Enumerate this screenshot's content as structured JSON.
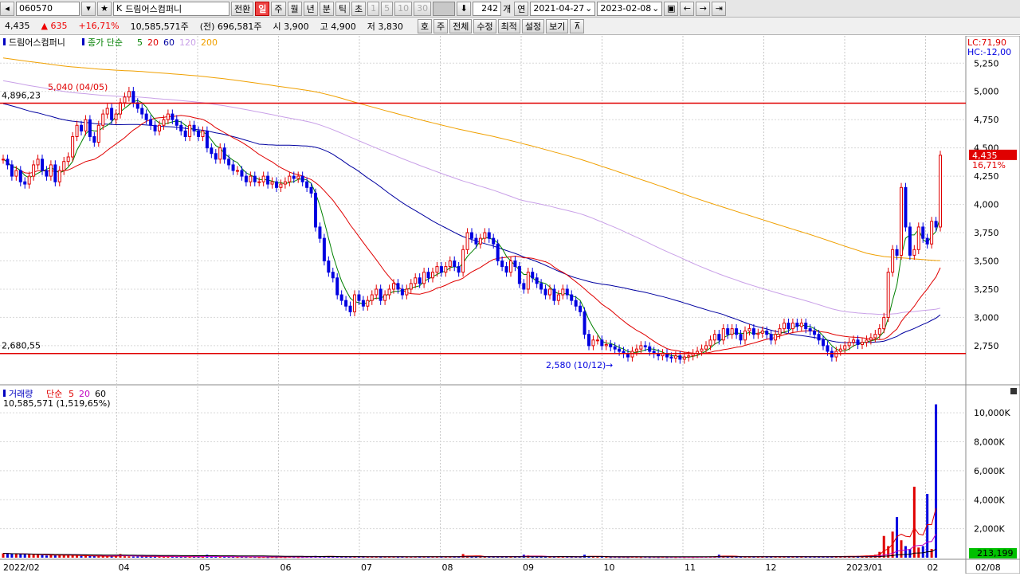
{
  "toolbar": {
    "code": "060570",
    "market_prefix": "K",
    "name": "드림어스컴퍼니",
    "switch_label": "전환",
    "periods": [
      "일",
      "주",
      "월",
      "년",
      "분",
      "틱",
      "초"
    ],
    "active_period": "일",
    "minute_options": [
      "1",
      "5",
      "10",
      "30"
    ],
    "count": "242",
    "count_unit": "개",
    "date_mode": "연",
    "date_from": "2021-04-27",
    "date_to": "2023-02-08"
  },
  "quote": {
    "price": "4,435",
    "change": "▲ 635",
    "change_pct": "+16,71%",
    "volume": "10,585,571주",
    "prev_volume": "(전) 696,581주",
    "open": "시 3,900",
    "high": "고 4,900",
    "low": "저 3,830",
    "buttons": [
      "호",
      "주",
      "전체",
      "수정",
      "최적",
      "설정",
      "보기"
    ]
  },
  "price_panel": {
    "legend_name": "드림어스컴퍼니",
    "ma_label": "종가 단순",
    "ma_periods": [
      "5",
      "20",
      "60",
      "120",
      "200"
    ],
    "ma_colors": [
      "#008000",
      "#e00000",
      "#0000a0",
      "#c9a0e8",
      "#f0a000"
    ],
    "lc_label": "LC:71,90",
    "hc_label": "HC:-12,00",
    "hline_upper": "4,896,23",
    "hline_lower": "2,680,55",
    "hline_upper_value": 4896.23,
    "hline_lower_value": 2680.55,
    "max_annotation": "5,040 (04/05)",
    "max_value": 5040,
    "min_annotation": "2,580 (10/12)",
    "min_value": 2580,
    "current_price_tag": "4,435",
    "current_pct_tag": "16,71%",
    "current_value": 4435,
    "y_ticks": [
      "5,250",
      "5,000",
      "4,750",
      "4,500",
      "4,250",
      "4,000",
      "3,750",
      "3,500",
      "3,250",
      "3,000",
      "2,750"
    ],
    "y_tick_values": [
      5250,
      5000,
      4750,
      4500,
      4250,
      4000,
      3750,
      3500,
      3250,
      3000,
      2750
    ],
    "y_range": [
      2580,
      5400
    ]
  },
  "volume_panel": {
    "legend_name": "거래량",
    "ma_label": "단순",
    "ma_periods": [
      "5",
      "20",
      "60"
    ],
    "ma_colors": [
      "#e00000",
      "#c000c0",
      "#000000"
    ],
    "current_volume": "10,585,571 (1,519,65%)",
    "y_ticks": [
      "10,000K",
      "8,000K",
      "6,000K",
      "4,000K",
      "2,000K"
    ],
    "y_tick_values": [
      10000,
      8000,
      6000,
      4000,
      2000
    ],
    "y_range": [
      0,
      11000
    ],
    "last_tag": "213,199"
  },
  "x_axis": {
    "labels": [
      "2022/02",
      "04",
      "05",
      "06",
      "07",
      "08",
      "09",
      "10",
      "11",
      "12",
      "2023/01",
      "02",
      "02/08"
    ]
  },
  "chart_data": {
    "type": "candlestick",
    "start_date": "2022-02-01",
    "days_per_candle": 1.5,
    "price_closes": [
      4400,
      4350,
      4250,
      4300,
      4200,
      4180,
      4250,
      4350,
      4400,
      4300,
      4250,
      4350,
      4200,
      4300,
      4380,
      4420,
      4600,
      4700,
      4650,
      4750,
      4600,
      4550,
      4700,
      4800,
      4850,
      4750,
      4800,
      4900,
      4950,
      5000,
      4900,
      4850,
      4800,
      4750,
      4700,
      4650,
      4700,
      4750,
      4800,
      4750,
      4700,
      4650,
      4600,
      4700,
      4650,
      4600,
      4650,
      4500,
      4450,
      4400,
      4500,
      4400,
      4350,
      4300,
      4300,
      4250,
      4200,
      4250,
      4200,
      4200,
      4250,
      4180,
      4200,
      4150,
      4180,
      4200,
      4250,
      4230,
      4250,
      4200,
      4150,
      4100,
      3800,
      3700,
      3500,
      3400,
      3350,
      3200,
      3150,
      3100,
      3050,
      3200,
      3150,
      3100,
      3150,
      3200,
      3250,
      3150,
      3200,
      3250,
      3300,
      3250,
      3200,
      3250,
      3300,
      3350,
      3300,
      3400,
      3350,
      3400,
      3450,
      3400,
      3450,
      3500,
      3450,
      3400,
      3600,
      3750,
      3700,
      3650,
      3700,
      3750,
      3700,
      3650,
      3500,
      3450,
      3400,
      3500,
      3450,
      3300,
      3250,
      3400,
      3350,
      3300,
      3250,
      3200,
      3250,
      3150,
      3200,
      3250,
      3200,
      3150,
      3100,
      3050,
      2850,
      2750,
      2800,
      2800,
      2750,
      2760,
      2740,
      2720,
      2700,
      2680,
      2650,
      2700,
      2720,
      2750,
      2740,
      2700,
      2680,
      2660,
      2680,
      2650,
      2640,
      2660,
      2630,
      2650,
      2660,
      2680,
      2700,
      2720,
      2750,
      2800,
      2850,
      2800,
      2900,
      2850,
      2900,
      2850,
      2800,
      2880,
      2900,
      2850,
      2860,
      2880,
      2850,
      2800,
      2850,
      2900,
      2950,
      2900,
      2950,
      2920,
      2950,
      2900,
      2880,
      2850,
      2800,
      2750,
      2700,
      2650,
      2700,
      2720,
      2750,
      2780,
      2800,
      2760,
      2780,
      2800,
      2820,
      2850,
      2900,
      3000,
      3400,
      3600,
      3550,
      4150,
      3800,
      3550,
      3600,
      3800,
      3700,
      3650,
      3850,
      3800,
      4435
    ],
    "volume_k": [
      300,
      280,
      250,
      260,
      240,
      230,
      220,
      210,
      200,
      180,
      150,
      200,
      160,
      180,
      170,
      160,
      150,
      140,
      130,
      120,
      130,
      110,
      100,
      100,
      90,
      110,
      120,
      250,
      100,
      90,
      80,
      90,
      100,
      90,
      80,
      80,
      70,
      80,
      90,
      80,
      70,
      60,
      70,
      60,
      70,
      60,
      50,
      200,
      90,
      80,
      70,
      60,
      70,
      60,
      50,
      60,
      50,
      60,
      50,
      40,
      50,
      40,
      50,
      40,
      50,
      40,
      60,
      50,
      40,
      50,
      60,
      80,
      120,
      90,
      100,
      80,
      70,
      60,
      60,
      50,
      60,
      70,
      60,
      50,
      60,
      70,
      60,
      50,
      60,
      70,
      60,
      50,
      60,
      50,
      60,
      70,
      80,
      60,
      70,
      60,
      70,
      60,
      70,
      80,
      60,
      70,
      250,
      120,
      90,
      80,
      70,
      60,
      70,
      60,
      70,
      60,
      70,
      60,
      70,
      60,
      200,
      150,
      80,
      70,
      60,
      70,
      60,
      70,
      60,
      70,
      60,
      50,
      60,
      50,
      200,
      100,
      60,
      50,
      60,
      50,
      40,
      50,
      40,
      50,
      40,
      60,
      50,
      40,
      50,
      40,
      50,
      40,
      50,
      40,
      50,
      40,
      50,
      40,
      50,
      40,
      50,
      60,
      70,
      80,
      90,
      200,
      100,
      80,
      70,
      60,
      70,
      60,
      70,
      60,
      70,
      80,
      60,
      70,
      60,
      70,
      60,
      70,
      60,
      70,
      60,
      70,
      60,
      70,
      60,
      70,
      80,
      90,
      100,
      80,
      90,
      100,
      110,
      120,
      130,
      140,
      160,
      200,
      400,
      1500,
      800,
      1800,
      2800,
      1200,
      800,
      600,
      4900,
      700,
      800,
      4400,
      600,
      10585
    ]
  }
}
